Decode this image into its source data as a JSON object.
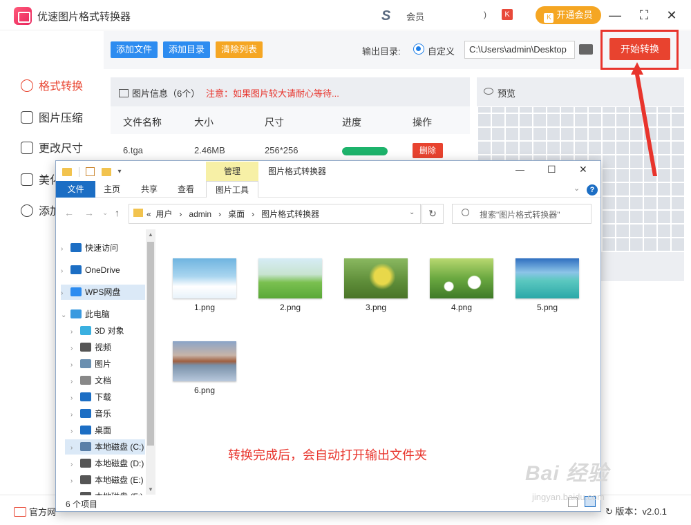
{
  "app": {
    "title": "优速图片格式转换器",
    "vip_logo": "S",
    "vip_text": "会员",
    "user_chevron": ")",
    "user_badge": "K",
    "vip_button": "开通会员",
    "vip_button_icon": "K",
    "window_controls": [
      "—",
      "⛶",
      "✕"
    ]
  },
  "sidebar": {
    "items": [
      {
        "label": "格式转换",
        "icon": "format-convert-icon",
        "active": true
      },
      {
        "label": "图片压缩",
        "icon": "compress-icon",
        "active": false
      },
      {
        "label": "更改尺寸",
        "icon": "resize-icon",
        "active": false
      },
      {
        "label": "美化",
        "icon": "beautify-icon",
        "active": false
      },
      {
        "label": "添加",
        "icon": "watermark-icon",
        "active": false
      }
    ]
  },
  "toolbar": {
    "add_file": "添加文件",
    "add_folder": "添加目录",
    "clear_list": "清除列表",
    "output_label": "输出目录:",
    "radio_custom": "自定义",
    "output_path": "C:\\Users\\admin\\Desktop",
    "start_button": "开始转换",
    "colors": {
      "blue": "#2d8cf0",
      "orange": "#f5a623",
      "red": "#e8432f"
    }
  },
  "file_panel": {
    "title": "图片信息（6个）",
    "note": "注意：如果图片较大请耐心等待...",
    "columns": [
      "文件名称",
      "大小",
      "尺寸",
      "进度",
      "操作"
    ],
    "rows": [
      {
        "name": "6.tga",
        "size": "2.46MB",
        "dimensions": "256*256",
        "progress": 1.0,
        "action": "删除"
      }
    ]
  },
  "preview": {
    "title": "预览"
  },
  "footer": {
    "site": "官方网",
    "version": "版本：v2.0.1"
  },
  "explorer": {
    "manage_tab": "管理",
    "window_title": "图片格式转换器",
    "ribbon_tabs": [
      "文件",
      "主页",
      "共享",
      "查看",
      "图片工具"
    ],
    "window_controls": [
      "—",
      "☐",
      "✕"
    ],
    "help": "?",
    "breadcrumb": [
      "«",
      "用户",
      "›",
      "admin",
      "›",
      "桌面",
      "›",
      "图片格式转换器"
    ],
    "search_placeholder": "搜索\"图片格式转换器\"",
    "tree": [
      {
        "label": "快速访问",
        "icon": "star-icon",
        "color": "#1c6ec4"
      },
      {
        "label": "OneDrive",
        "icon": "cloud-icon",
        "color": "#1c6ec4"
      },
      {
        "label": "WPS网盘",
        "icon": "wps-cloud-icon",
        "color": "#2d8cf0",
        "selected": true
      },
      {
        "label": "此电脑",
        "icon": "computer-icon",
        "color": "#3a9ae0",
        "expanded": true
      },
      {
        "label": "3D 对象",
        "icon": "3d-objects-icon",
        "color": "#3ab0e0"
      },
      {
        "label": "视频",
        "icon": "video-icon",
        "color": "#555555"
      },
      {
        "label": "图片",
        "icon": "pictures-icon",
        "color": "#6a8fb0"
      },
      {
        "label": "文档",
        "icon": "documents-icon",
        "color": "#888888"
      },
      {
        "label": "下载",
        "icon": "download-icon",
        "color": "#1c6ec4"
      },
      {
        "label": "音乐",
        "icon": "music-icon",
        "color": "#1c6ec4"
      },
      {
        "label": "桌面",
        "icon": "desktop-icon",
        "color": "#1c6ec4"
      },
      {
        "label": "本地磁盘 (C:)",
        "icon": "drive-c-icon",
        "color": "#5a7fa8",
        "selected": true
      },
      {
        "label": "本地磁盘 (D:)",
        "icon": "drive-d-icon",
        "color": "#555555"
      },
      {
        "label": "本地磁盘 (E:)",
        "icon": "drive-e-icon",
        "color": "#555555"
      },
      {
        "label": "本地磁盘 (F:)",
        "icon": "drive-f-icon",
        "color": "#555555"
      }
    ],
    "files": [
      {
        "name": "1.png",
        "thumb": "sky-clouds"
      },
      {
        "name": "2.png",
        "thumb": "green-meadow"
      },
      {
        "name": "3.png",
        "thumb": "yellow-flowers"
      },
      {
        "name": "4.png",
        "thumb": "daisies"
      },
      {
        "name": "5.png",
        "thumb": "pier-sea"
      },
      {
        "name": "6.png",
        "thumb": "lake-house"
      }
    ],
    "status_count": "6 个项目"
  },
  "annotation": "转换完成后，会自动打开输出文件夹",
  "watermark": "Bai 经验",
  "watermark_sub": "jingyan.baidu.com"
}
